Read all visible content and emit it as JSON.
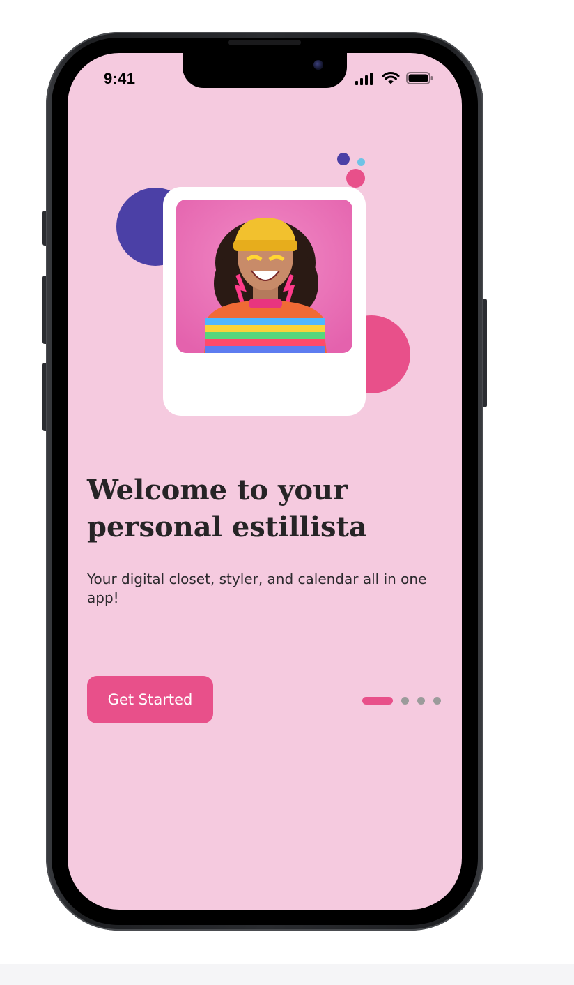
{
  "status_bar": {
    "time": "9:41",
    "signal_icon": "cellular-signal-icon",
    "wifi_icon": "wifi-icon",
    "battery_icon": "battery-icon"
  },
  "colors": {
    "screen_background": "#f5cadf",
    "accent_pink": "#e8508a",
    "indigo": "#4b40a6",
    "light_blue": "#6fc3e6",
    "text_dark": "#262426",
    "pager_inactive": "#9b9b9b"
  },
  "hero": {
    "image": "smiling-woman-photo",
    "image_description_icon": "person-photo"
  },
  "onboarding": {
    "headline": "Welcome to your personal estillista",
    "subtitle": "Your digital closet, styler, and calendar all in one app!",
    "cta_label": "Get Started"
  },
  "pager": {
    "total": 4,
    "active_index": 0
  }
}
